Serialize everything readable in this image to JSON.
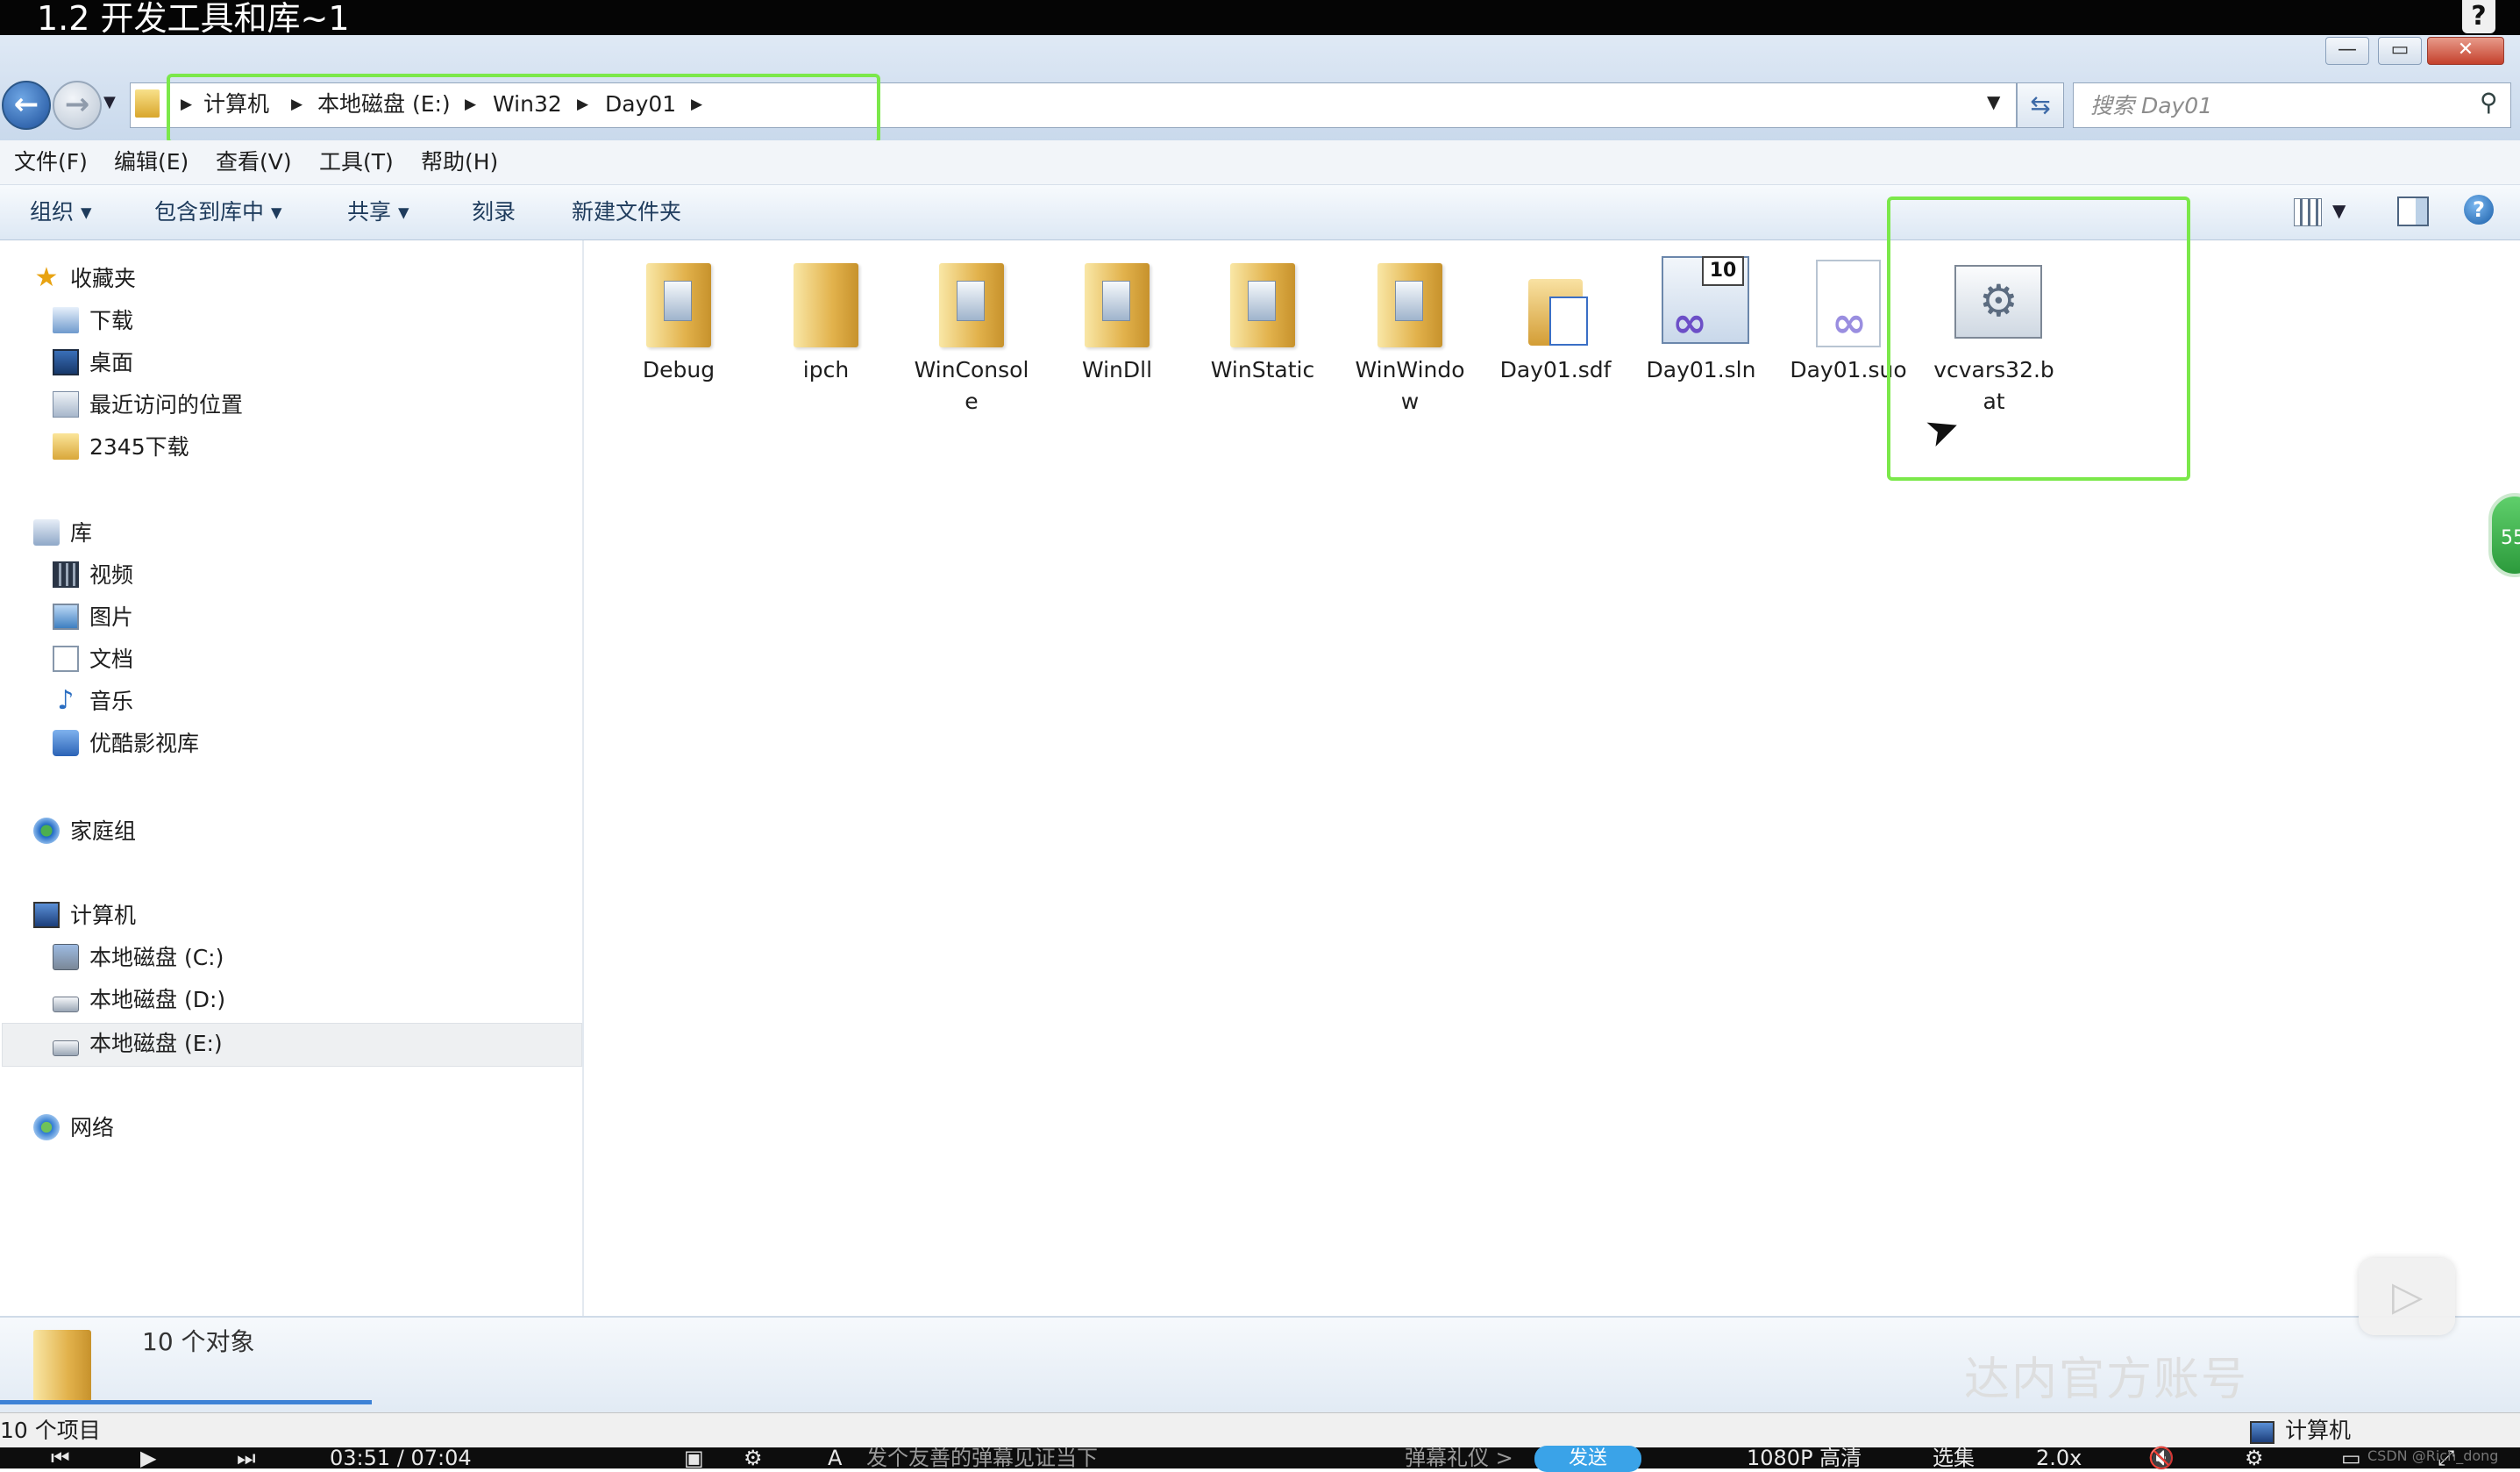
{
  "video": {
    "title": "1.2 开发工具和库~1",
    "help": "?",
    "current_time": "03:51 / 07:04",
    "danmaku_placeholder": "发个友善的弹幕见证当下",
    "danmaku_etiquette": "弹幕礼仪 >",
    "send": "发送",
    "quality": "1080P 高清",
    "episodes": "选集",
    "speed": "2.0x",
    "side_badge": "55",
    "watermark": "达内官方账号",
    "credit": "CSDN @Rich_dong"
  },
  "window": {
    "minimize": "—",
    "maximize": "▭",
    "close": "✕"
  },
  "address": {
    "crumbs": [
      "计算机",
      "本地磁盘 (E:)",
      "Win32",
      "Day01"
    ],
    "search_placeholder": "搜索 Day01"
  },
  "menu": [
    "文件(F)",
    "编辑(E)",
    "查看(V)",
    "工具(T)",
    "帮助(H)"
  ],
  "commands": {
    "organize": "组织 ▾",
    "include_library": "包含到库中 ▾",
    "share": "共享 ▾",
    "burn": "刻录",
    "new_folder": "新建文件夹"
  },
  "nav": {
    "favorites": "收藏夹",
    "downloads": "下载",
    "desktop": "桌面",
    "recent": "最近访问的位置",
    "dl2345": "2345下载",
    "libraries": "库",
    "videos": "视频",
    "pictures": "图片",
    "documents": "文档",
    "music": "音乐",
    "youku": "优酷影视库",
    "homegroup": "家庭组",
    "computer": "计算机",
    "drive_c": "本地磁盘 (C:)",
    "drive_d": "本地磁盘 (D:)",
    "drive_e": "本地磁盘 (E:)",
    "network": "网络"
  },
  "files": [
    {
      "name": "Debug",
      "type": "folder"
    },
    {
      "name": "ipch",
      "type": "folder"
    },
    {
      "name": "WinConsole",
      "type": "folder"
    },
    {
      "name": "WinDll",
      "type": "folder"
    },
    {
      "name": "WinStatic",
      "type": "folder"
    },
    {
      "name": "WinWindow",
      "type": "folder"
    },
    {
      "name": "Day01.sdf",
      "type": "sdf"
    },
    {
      "name": "Day01.sln",
      "type": "sln",
      "badge": "10"
    },
    {
      "name": "Day01.suo",
      "type": "suo"
    },
    {
      "name": "vcvars32.bat",
      "type": "bat"
    }
  ],
  "details": {
    "count": "10 个对象"
  },
  "status": {
    "items": "10 个项目",
    "location": "计算机"
  }
}
